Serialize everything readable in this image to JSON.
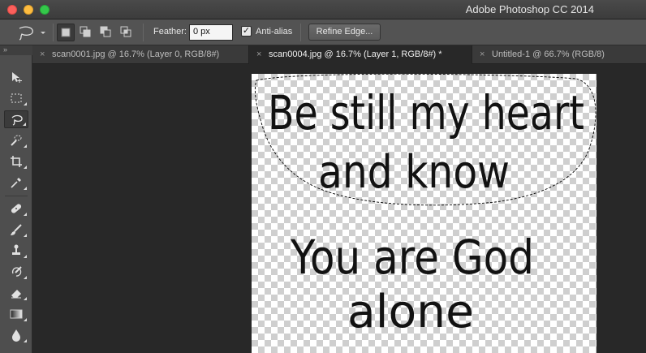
{
  "window": {
    "app_title": "Adobe Photoshop CC 2014"
  },
  "options_bar": {
    "feather_label": "Feather:",
    "feather_value": "0 px",
    "anti_alias_label": "Anti-alias",
    "anti_alias_checked": true,
    "refine_edge_label": "Refine Edge..."
  },
  "tabs": [
    {
      "close": "×",
      "label": "scan0001.jpg @ 16.7% (Layer 0, RGB/8#)",
      "active": false
    },
    {
      "close": "×",
      "label": "scan0004.jpg @ 16.7% (Layer 1, RGB/8#) *",
      "active": true
    },
    {
      "close": "×",
      "label": "Untitled-1 @ 66.7% (RGB/8)",
      "active": false
    }
  ],
  "toolbox": {
    "grip": "»",
    "tools": [
      "move-tool",
      "marquee-tool",
      "lasso-tool",
      "quick-selection-tool",
      "crop-tool",
      "eyedropper-tool",
      "healing-brush-tool",
      "brush-tool",
      "clone-stamp-tool",
      "history-brush-tool",
      "eraser-tool",
      "gradient-tool",
      "blur-tool"
    ],
    "active_tool": "lasso-tool"
  },
  "document": {
    "lines": [
      "Be still my heart",
      "and know",
      "You are God",
      "alone"
    ],
    "ink_color": "#121212"
  }
}
